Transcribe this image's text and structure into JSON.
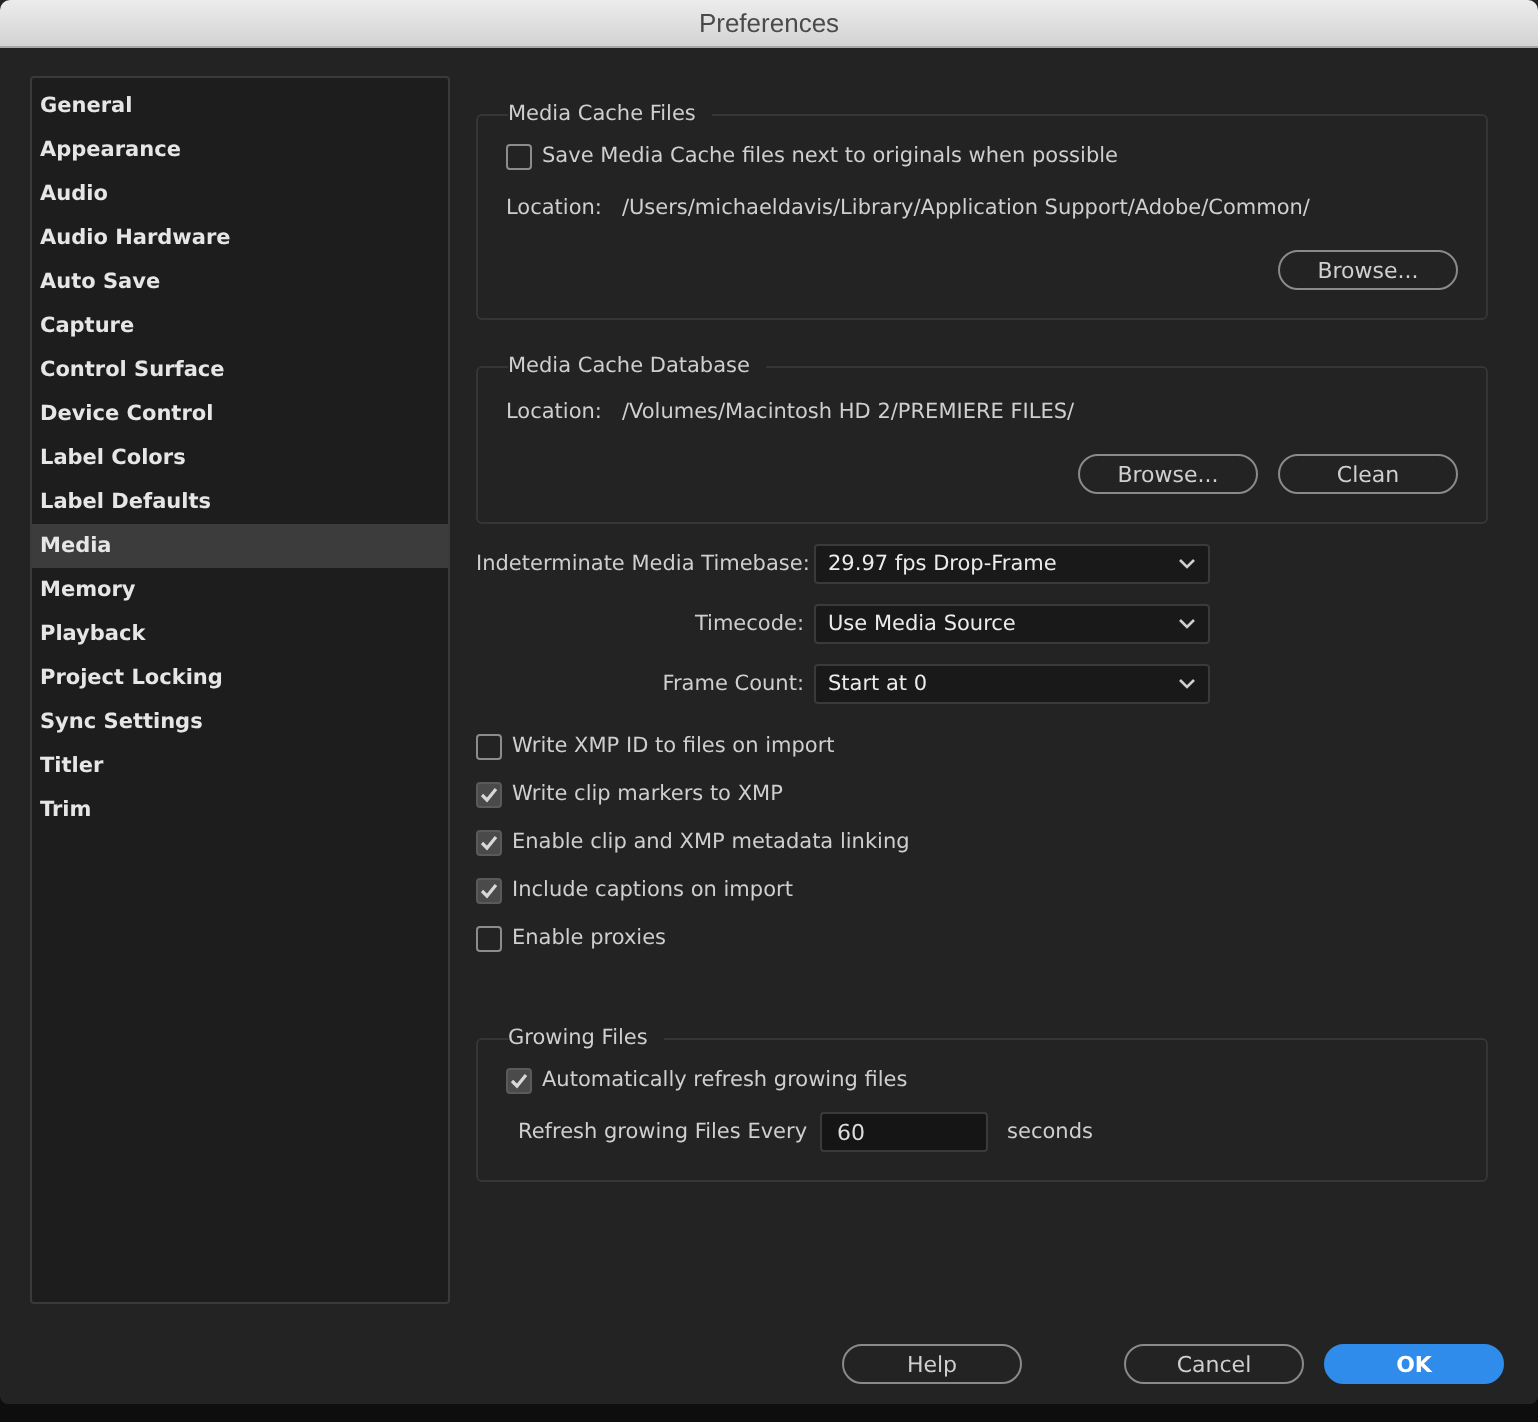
{
  "window": {
    "title": "Preferences"
  },
  "sidebar": {
    "items": [
      {
        "label": "General",
        "selected": false
      },
      {
        "label": "Appearance",
        "selected": false
      },
      {
        "label": "Audio",
        "selected": false
      },
      {
        "label": "Audio Hardware",
        "selected": false
      },
      {
        "label": "Auto Save",
        "selected": false
      },
      {
        "label": "Capture",
        "selected": false
      },
      {
        "label": "Control Surface",
        "selected": false
      },
      {
        "label": "Device Control",
        "selected": false
      },
      {
        "label": "Label Colors",
        "selected": false
      },
      {
        "label": "Label Defaults",
        "selected": false
      },
      {
        "label": "Media",
        "selected": true
      },
      {
        "label": "Memory",
        "selected": false
      },
      {
        "label": "Playback",
        "selected": false
      },
      {
        "label": "Project Locking",
        "selected": false
      },
      {
        "label": "Sync Settings",
        "selected": false
      },
      {
        "label": "Titler",
        "selected": false
      },
      {
        "label": "Trim",
        "selected": false
      }
    ]
  },
  "media_cache_files": {
    "title": "Media Cache Files",
    "option": {
      "label": "Save Media Cache files next to originals when possible",
      "checked": false
    },
    "location_label": "Location:",
    "location": "/Users/michaeldavis/Library/Application Support/Adobe/Common/",
    "buttons": [
      "Browse..."
    ]
  },
  "media_cache_database": {
    "title": "Media Cache Database",
    "location_label": "Location:",
    "location": "/Volumes/Macintosh HD 2/PREMIERE FILES/",
    "buttons": [
      "Browse...",
      "Clean"
    ]
  },
  "dropdowns": [
    {
      "label": "Indeterminate Media Timebase:",
      "value": "29.97 fps Drop-Frame"
    },
    {
      "label": "Timecode:",
      "value": "Use Media Source"
    },
    {
      "label": "Frame Count:",
      "value": "Start at 0"
    }
  ],
  "options": [
    {
      "label": "Write XMP ID to files on import",
      "checked": false
    },
    {
      "label": "Write clip markers to XMP",
      "checked": true
    },
    {
      "label": "Enable clip and XMP metadata linking",
      "checked": true
    },
    {
      "label": "Include captions on import",
      "checked": true
    },
    {
      "label": "Enable proxies",
      "checked": false
    }
  ],
  "growing_files": {
    "title": "Growing Files",
    "option": {
      "label": "Automatically refresh growing files",
      "checked": true
    },
    "refresh_label": "Refresh growing Files Every",
    "refresh_value": "60",
    "unit": "seconds"
  },
  "buttons": [
    {
      "label": "Help",
      "primary": false
    },
    {
      "label": "Cancel",
      "primary": false
    },
    {
      "label": "OK",
      "primary": true
    }
  ]
}
